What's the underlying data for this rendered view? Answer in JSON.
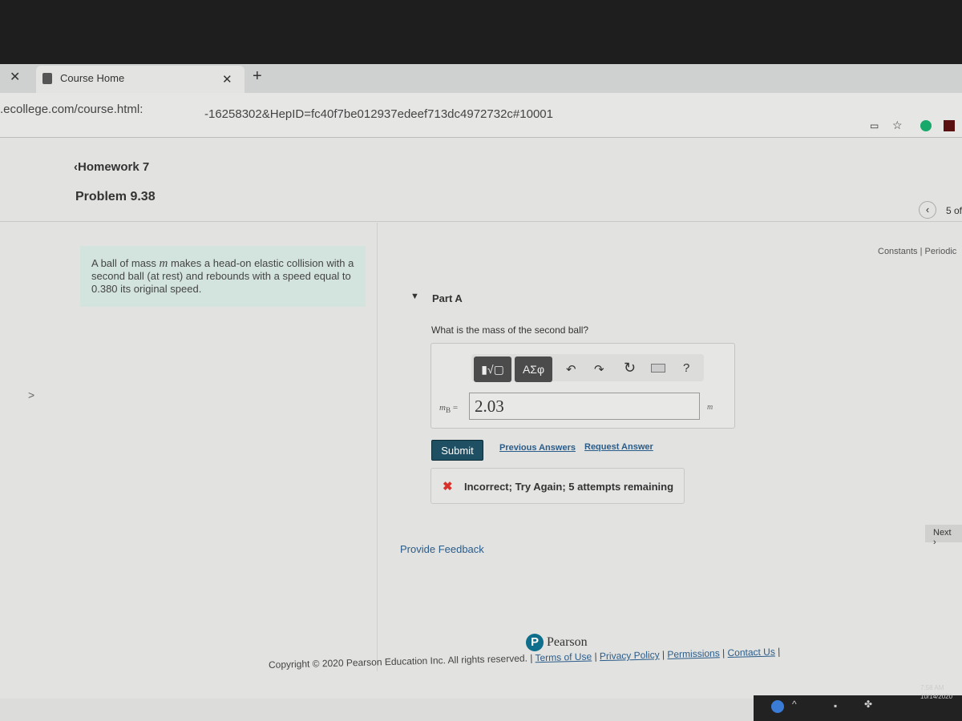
{
  "browser": {
    "tab_title": "Course Home",
    "url_left": ".ecollege.com/course.html:",
    "url_right": "-16258302&HepID=fc40f7be012937edeef713dc4972732c#10001"
  },
  "header": {
    "back_link": "Homework 7",
    "problem_title": "Problem 9.38",
    "pager": "5 of",
    "constants_link": "Constants",
    "periodic_link": "Periodic"
  },
  "problem": {
    "text_before": "A ball of mass ",
    "var": "m",
    "text_after": " makes a head-on elastic collision with a second ball (at rest) and rebounds with a speed equal to 0.380 its original speed."
  },
  "part": {
    "label": "Part A",
    "question": "What is the mass of the second ball?",
    "toolbar": {
      "templates": "▮√▢",
      "greek": "ΑΣφ",
      "help": "?"
    },
    "input_label": "m",
    "input_sub": "B",
    "input_eq": "=",
    "input_value": "2.03",
    "unit": "m",
    "submit": "Submit",
    "previous_answers": "Previous Answers",
    "request_answer": "Request Answer",
    "feedback": "Incorrect; Try Again; 5 attempts remaining"
  },
  "provide_feedback": "Provide Feedback",
  "next": "Next",
  "footer": {
    "brand": "Pearson",
    "copyright": "Copyright © 2020 Pearson Education Inc. All rights reserved.",
    "links": [
      "Terms of Use",
      "Privacy Policy",
      "Permissions",
      "Contact Us"
    ]
  },
  "taskbar": {
    "time": "7:58 AM",
    "date": "10/14/2020"
  },
  "colors": {
    "submit": "#1e4f63",
    "error": "#d9302c",
    "problem_bg": "#d3e3dd",
    "pearson": "#0e6e8c"
  }
}
